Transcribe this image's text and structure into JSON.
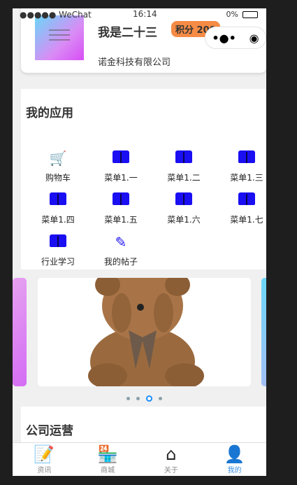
{
  "status": {
    "signal": "●●●●● WeChat",
    "time": "16:14",
    "battery": "0%"
  },
  "profile": {
    "name": "我是二十三",
    "points_badge": "积分 200",
    "company": "诺金科技有限公司"
  },
  "capsule": {
    "menu": "•●•",
    "close": "◉"
  },
  "apps": {
    "title": "我的应用",
    "items": [
      {
        "label": "购物车",
        "icon": "cart-icon"
      },
      {
        "label": "菜单1.一",
        "icon": "book-icon"
      },
      {
        "label": "菜单1.二",
        "icon": "book-icon"
      },
      {
        "label": "菜单1.三",
        "icon": "book-icon"
      },
      {
        "label": "菜单1.四",
        "icon": "book-icon"
      },
      {
        "label": "菜单1.五",
        "icon": "book-icon"
      },
      {
        "label": "菜单1.六",
        "icon": "book-icon"
      },
      {
        "label": "菜单1.七",
        "icon": "book-icon"
      },
      {
        "label": "行业学习",
        "icon": "book-icon"
      },
      {
        "label": "我的帖子",
        "icon": "edit-icon"
      }
    ]
  },
  "carousel": {
    "count": 4,
    "active_index": 2
  },
  "operations": {
    "title": "公司运营"
  },
  "tabbar": [
    {
      "label": "资讯"
    },
    {
      "label": "商城"
    },
    {
      "label": "关于"
    },
    {
      "label": "我的",
      "active": true
    }
  ]
}
